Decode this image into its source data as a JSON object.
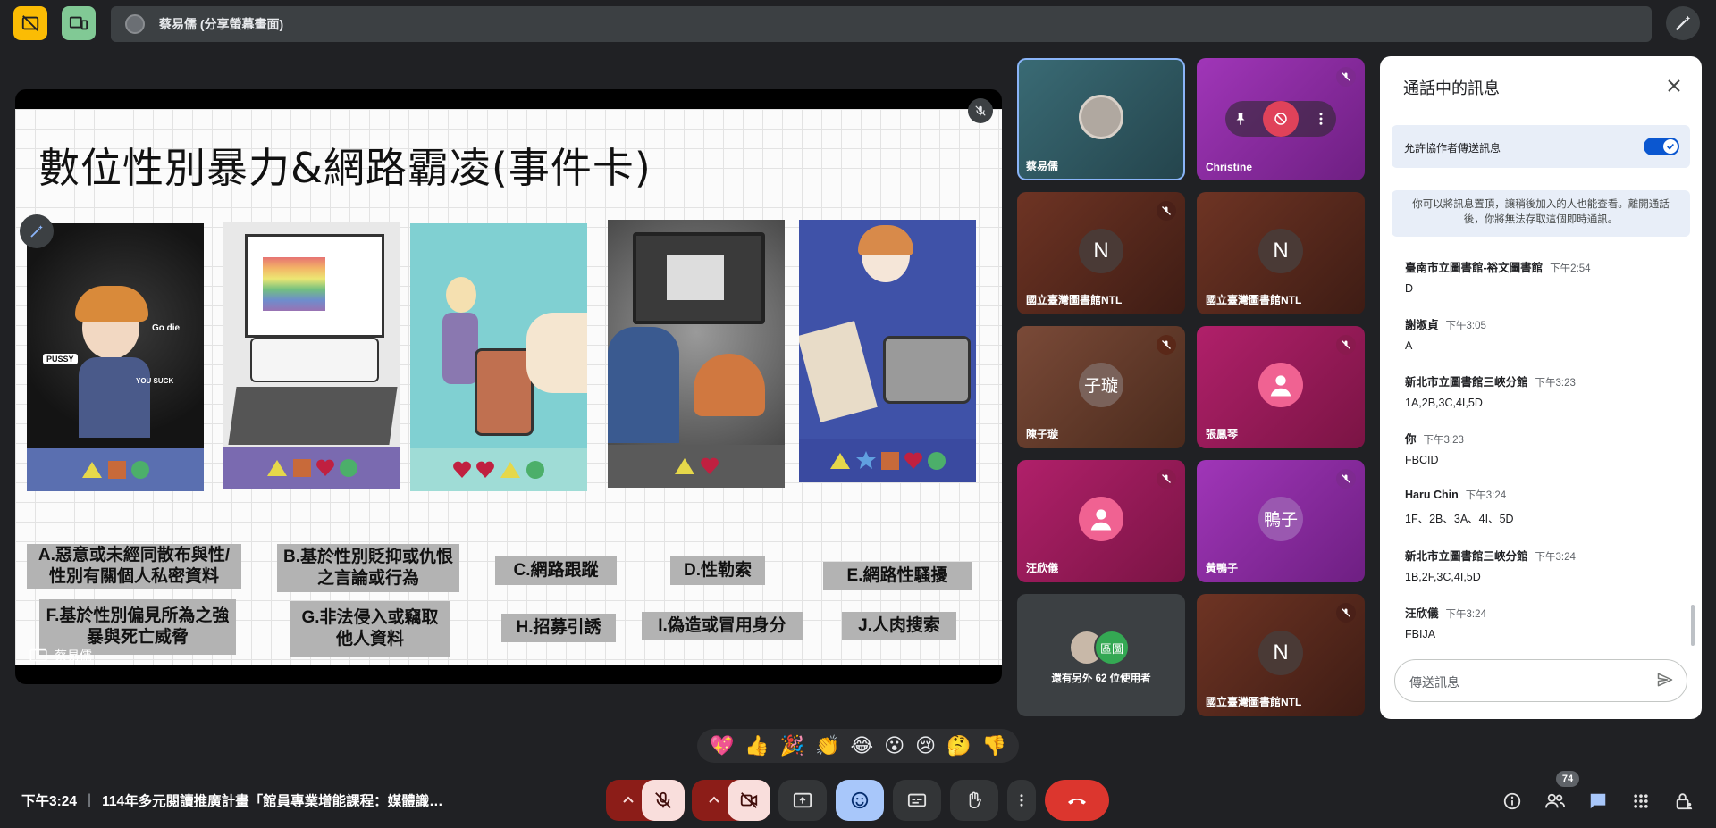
{
  "meeting": {
    "presenter_banner": "蔡易儒 (分享螢幕畫面)",
    "presenter_name": "蔡易儒",
    "clock": "下午3:24",
    "meeting_title": "114年多元閱讀推廣計畫「館員專業增能課程：媒體識…",
    "participant_count": "74"
  },
  "slide": {
    "title": "數位性別暴力&網路霸凌(事件卡)",
    "labels": {
      "A": "A.惡意或未經同散布與性/性別有關個人私密資料",
      "B": "B.基於性別貶抑或仇恨之言論或行為",
      "C": "C.網路跟蹤",
      "D": "D.性勒索",
      "E": "E.網路性騷擾",
      "F": "F.基於性別偏見所為之強暴與死亡威脅",
      "G": "G.非法侵入或竊取他人資料",
      "H": "H.招募引誘",
      "I": "I.偽造或冒用身分",
      "J": "J.人肉搜索"
    },
    "card_texts": {
      "go_die": "Go die",
      "pussy": "PUSSY",
      "you_suck": "YOU SUCK"
    }
  },
  "tiles": [
    {
      "name": "蔡易儒",
      "type": "photo",
      "bg": "#2e5a63"
    },
    {
      "name": "Christine",
      "type": "purple",
      "bg": "#8b2a9e"
    },
    {
      "name": "國立臺灣圖書館NTL",
      "initial": "N",
      "bg": "#5a2a1e"
    },
    {
      "name": "國立臺灣圖書館NTL",
      "initial": "N",
      "bg": "#5a2a1e"
    },
    {
      "name": "陳子璇",
      "initial": "子璇",
      "bg": "#6b3a2a"
    },
    {
      "name": "張鳳琴",
      "type": "person",
      "bg": "#a01c5a"
    },
    {
      "name": "汪欣儀",
      "type": "person",
      "bg": "#a01c5a"
    },
    {
      "name": "黃鴨子",
      "initial": "鴨子",
      "bg": "#8b2a9e"
    },
    {
      "name": "",
      "more": "還有另外 62 位使用者",
      "chip": "區圖",
      "bg": "#3c4043"
    },
    {
      "name": "國立臺灣圖書館NTL",
      "initial": "N",
      "bg": "#5a2a1e"
    }
  ],
  "chat": {
    "title": "通話中的訊息",
    "allow_label": "允許協作者傳送訊息",
    "allow_enabled": true,
    "info": "你可以將訊息置頂，讓稍後加入的人也能查看。離開通話後，你將無法存取這個即時通訊。",
    "messages": [
      {
        "sender": "臺南市立圖書館-裕文圖書館",
        "time": "下午2:54",
        "text": "D"
      },
      {
        "sender": "謝淑貞",
        "time": "下午3:05",
        "text": "A"
      },
      {
        "sender": "新北市立圖書館三峽分館",
        "time": "下午3:23",
        "text": "1A,2B,3C,4I,5D"
      },
      {
        "sender": "你",
        "time": "下午3:23",
        "text": "FBCID"
      },
      {
        "sender": "Haru Chin",
        "time": "下午3:24",
        "text": "1F、2B、3A、4I、5D"
      },
      {
        "sender": "新北市立圖書館三峽分館",
        "time": "下午3:24",
        "text": "1B,2F,3C,4I,5D"
      },
      {
        "sender": "汪欣儀",
        "time": "下午3:24",
        "text": "FBIJA"
      }
    ],
    "input_placeholder": "傳送訊息"
  },
  "reactions": [
    "💖",
    "👍",
    "🎉",
    "👏",
    "😂",
    "😮",
    "😢",
    "🤔",
    "👎"
  ],
  "colors": {
    "accent": "#0b57d0",
    "hangup": "#d93025",
    "muted_red": "#f9dedc",
    "emoji_active": "#a8c7fa"
  }
}
